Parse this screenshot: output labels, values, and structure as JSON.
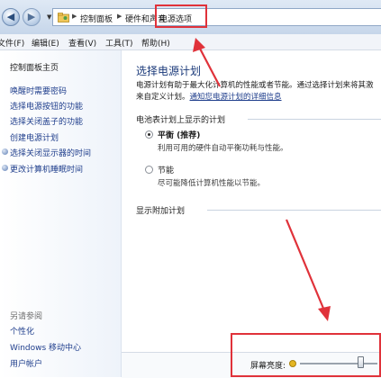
{
  "breadcrumb": {
    "items": [
      "控制面板",
      "硬件和声音",
      "电源选项"
    ]
  },
  "menu": [
    "文件(F)",
    "编辑(E)",
    "查看(V)",
    "工具(T)",
    "帮助(H)"
  ],
  "sidebar": {
    "home": "控制面板主页",
    "links": [
      "唤醒时需要密码",
      "选择电源按钮的功能",
      "选择关闭盖子的功能",
      "创建电源计划",
      "选择关闭显示器的时间",
      "更改计算机睡眠时间"
    ],
    "see_also_header": "另请参阅",
    "see_also": [
      "个性化",
      "Windows 移动中心",
      "用户帐户"
    ]
  },
  "main": {
    "title": "选择电源计划",
    "desc_line1": "电源计划有助于最大化计算机的性能或者节能。通过选择计划来将其激",
    "desc_line2_prefix": "来自定义计划。",
    "desc_link": "通知您电源计划的详细信息",
    "battery_section": "电池表计划上显示的计划",
    "plans": [
      {
        "name": "平衡 (推荐)",
        "desc": "利用可用的硬件自动平衡功耗与性能。",
        "selected": true
      },
      {
        "name": "节能",
        "desc": "尽可能降低计算机性能以节能。",
        "selected": false
      }
    ],
    "extra_section": "显示附加计划"
  },
  "brightness": {
    "label": "屏幕亮度:",
    "level_percent": 78
  },
  "colors": {
    "highlight": "#e0323a",
    "link": "#1f3e8c",
    "title": "#1b3a7a"
  }
}
